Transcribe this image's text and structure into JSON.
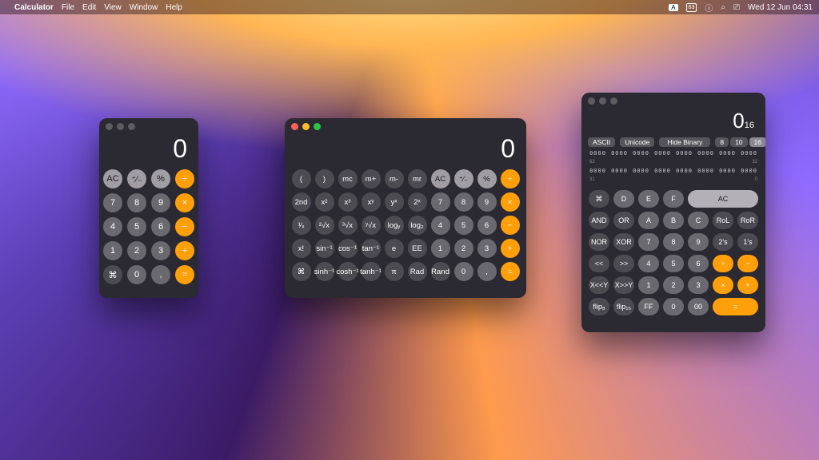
{
  "menubar": {
    "apple": "",
    "app": "Calculator",
    "items": [
      "File",
      "Edit",
      "View",
      "Window",
      "Help"
    ],
    "input_tag": "A",
    "battery_pct": "63",
    "datetime": "Wed 12 Jun  04:31"
  },
  "basic": {
    "display": "0",
    "rows": [
      [
        {
          "l": "AC",
          "c": "light"
        },
        {
          "l": "⁺∕₋",
          "c": "light"
        },
        {
          "l": "%",
          "c": "light"
        },
        {
          "l": "÷",
          "c": "orange"
        }
      ],
      [
        {
          "l": "7",
          "c": "num"
        },
        {
          "l": "8",
          "c": "num"
        },
        {
          "l": "9",
          "c": "num"
        },
        {
          "l": "×",
          "c": "orange"
        }
      ],
      [
        {
          "l": "4",
          "c": "num"
        },
        {
          "l": "5",
          "c": "num"
        },
        {
          "l": "6",
          "c": "num"
        },
        {
          "l": "−",
          "c": "orange"
        }
      ],
      [
        {
          "l": "1",
          "c": "num"
        },
        {
          "l": "2",
          "c": "num"
        },
        {
          "l": "3",
          "c": "num"
        },
        {
          "l": "+",
          "c": "orange"
        }
      ],
      [
        {
          "l": "⌘",
          "c": "dark"
        },
        {
          "l": "0",
          "c": "num"
        },
        {
          "l": ",",
          "c": "num"
        },
        {
          "l": "=",
          "c": "orange"
        }
      ]
    ]
  },
  "sci": {
    "display": "0",
    "rows": [
      [
        {
          "l": "(",
          "c": "dark"
        },
        {
          "l": ")",
          "c": "dark"
        },
        {
          "l": "mc",
          "c": "dark"
        },
        {
          "l": "m+",
          "c": "dark"
        },
        {
          "l": "m-",
          "c": "dark"
        },
        {
          "l": "mr",
          "c": "dark"
        },
        {
          "l": "AC",
          "c": "light"
        },
        {
          "l": "⁺∕₋",
          "c": "light"
        },
        {
          "l": "%",
          "c": "light"
        },
        {
          "l": "÷",
          "c": "orange"
        }
      ],
      [
        {
          "l": "2nd",
          "c": "dark"
        },
        {
          "l": "x²",
          "c": "dark"
        },
        {
          "l": "x³",
          "c": "dark"
        },
        {
          "l": "xʸ",
          "c": "dark"
        },
        {
          "l": "yˣ",
          "c": "dark"
        },
        {
          "l": "2ˣ",
          "c": "dark"
        },
        {
          "l": "7",
          "c": "num"
        },
        {
          "l": "8",
          "c": "num"
        },
        {
          "l": "9",
          "c": "num"
        },
        {
          "l": "×",
          "c": "orange"
        }
      ],
      [
        {
          "l": "¹∕ₓ",
          "c": "dark"
        },
        {
          "l": "²√x",
          "c": "dark"
        },
        {
          "l": "³√x",
          "c": "dark"
        },
        {
          "l": "ʸ√x",
          "c": "dark"
        },
        {
          "l": "logᵧ",
          "c": "dark"
        },
        {
          "l": "log₂",
          "c": "dark"
        },
        {
          "l": "4",
          "c": "num"
        },
        {
          "l": "5",
          "c": "num"
        },
        {
          "l": "6",
          "c": "num"
        },
        {
          "l": "−",
          "c": "orange"
        }
      ],
      [
        {
          "l": "x!",
          "c": "dark"
        },
        {
          "l": "sin⁻¹",
          "c": "dark"
        },
        {
          "l": "cos⁻¹",
          "c": "dark"
        },
        {
          "l": "tan⁻¹",
          "c": "dark"
        },
        {
          "l": "e",
          "c": "dark"
        },
        {
          "l": "EE",
          "c": "dark"
        },
        {
          "l": "1",
          "c": "num"
        },
        {
          "l": "2",
          "c": "num"
        },
        {
          "l": "3",
          "c": "num"
        },
        {
          "l": "+",
          "c": "orange"
        }
      ],
      [
        {
          "l": "⌘",
          "c": "dark"
        },
        {
          "l": "sinh⁻¹",
          "c": "dark"
        },
        {
          "l": "cosh⁻¹",
          "c": "dark"
        },
        {
          "l": "tanh⁻¹",
          "c": "dark"
        },
        {
          "l": "π",
          "c": "dark"
        },
        {
          "l": "Rad",
          "c": "dark"
        },
        {
          "l": "Rand",
          "c": "dark"
        },
        {
          "l": "0",
          "c": "num"
        },
        {
          "l": ",",
          "c": "num"
        },
        {
          "l": "=",
          "c": "orange"
        }
      ]
    ]
  },
  "prog": {
    "display_value": "0",
    "display_base": "16",
    "toolbar": {
      "ascii": "ASCII",
      "unicode": "Unicode",
      "hide_binary": "Hide Binary",
      "bases": [
        "8",
        "10",
        "16"
      ],
      "base_selected": "16"
    },
    "bit_indices": {
      "hi_left": "63",
      "hi_right": "32",
      "lo_left": "31",
      "lo_right": "0"
    },
    "rows": [
      [
        {
          "l": "⌘",
          "c": "dark"
        },
        {
          "l": "D",
          "c": "num"
        },
        {
          "l": "E",
          "c": "num"
        },
        {
          "l": "F",
          "c": "num"
        },
        {
          "l": "AC",
          "c": "aclite",
          "span": 3
        }
      ],
      [
        {
          "l": "AND",
          "c": "dark"
        },
        {
          "l": "OR",
          "c": "dark"
        },
        {
          "l": "A",
          "c": "num"
        },
        {
          "l": "B",
          "c": "num"
        },
        {
          "l": "C",
          "c": "num"
        },
        {
          "l": "RoL",
          "c": "dark"
        },
        {
          "l": "RoR",
          "c": "dark"
        }
      ],
      [
        {
          "l": "NOR",
          "c": "dark"
        },
        {
          "l": "XOR",
          "c": "dark"
        },
        {
          "l": "7",
          "c": "num"
        },
        {
          "l": "8",
          "c": "num"
        },
        {
          "l": "9",
          "c": "num"
        },
        {
          "l": "2's",
          "c": "dark"
        },
        {
          "l": "1's",
          "c": "dark"
        }
      ],
      [
        {
          "l": "<<",
          "c": "dark"
        },
        {
          "l": ">>",
          "c": "dark"
        },
        {
          "l": "4",
          "c": "num"
        },
        {
          "l": "5",
          "c": "num"
        },
        {
          "l": "6",
          "c": "num"
        },
        {
          "l": "÷",
          "c": "orange"
        },
        {
          "l": "−",
          "c": "orange"
        }
      ],
      [
        {
          "l": "X<<Y",
          "c": "dark"
        },
        {
          "l": "X>>Y",
          "c": "dark"
        },
        {
          "l": "1",
          "c": "num"
        },
        {
          "l": "2",
          "c": "num"
        },
        {
          "l": "3",
          "c": "num"
        },
        {
          "l": "×",
          "c": "orange"
        },
        {
          "l": "+",
          "c": "orange"
        }
      ],
      [
        {
          "l": "flip₈",
          "c": "dark"
        },
        {
          "l": "flip₁₆",
          "c": "dark"
        },
        {
          "l": "FF",
          "c": "num"
        },
        {
          "l": "0",
          "c": "num"
        },
        {
          "l": "00",
          "c": "num"
        },
        {
          "l": "=",
          "c": "orange",
          "span": 2
        }
      ]
    ]
  }
}
